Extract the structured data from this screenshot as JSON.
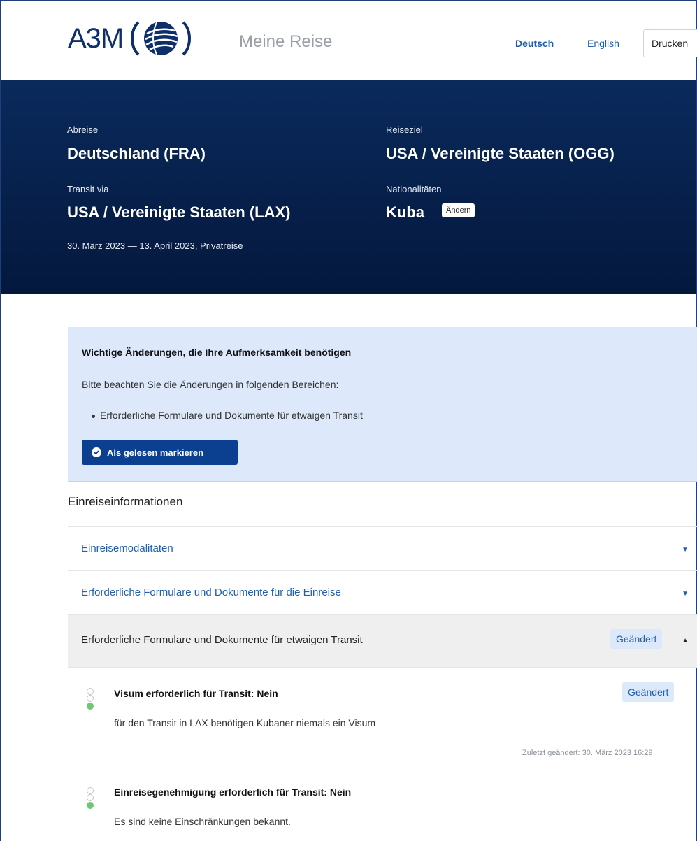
{
  "header": {
    "logo_text": "A3M",
    "tagline": "Meine Reise",
    "lang_de": "Deutsch",
    "lang_en": "English",
    "print_label": "Drucken"
  },
  "trip": {
    "departure_label": "Abreise",
    "departure_value": "Deutschland (FRA)",
    "destination_label": "Reiseziel",
    "destination_value": "USA / Vereinigte Staaten (OGG)",
    "transit_label": "Transit via",
    "transit_value": "USA / Vereinigte Staaten (LAX)",
    "nationality_label": "Nationalitäten",
    "nationality_value": "Kuba",
    "change_label": "Ändern",
    "meta": "30. März 2023 — 13. April 2023, Privatreise"
  },
  "notice": {
    "title": "Wichtige Änderungen, die Ihre Aufmerksamkeit benötigen",
    "text": "Bitte beachten Sie die Änderungen in folgenden Bereichen:",
    "bullet": "Erforderliche Formulare und Dokumente für etwaigen Transit",
    "button_label": "Als gelesen markieren"
  },
  "section_title": "Einreiseinformationen",
  "accordion": {
    "row1": "Einreisemodalitäten",
    "row2": "Erforderliche Formulare und Dokumente für die Einreise",
    "row3": "Erforderliche Formulare und Dokumente für etwaigen Transit",
    "changed_badge": "Geändert",
    "caret_down": "▼",
    "caret_up": "▲"
  },
  "items": [
    {
      "title": "Visum erforderlich für Transit: Nein",
      "text": "für den Transit in LAX benötigen Kubaner niemals ein Visum",
      "badge": "Geändert",
      "stamp": "Zuletzt geändert: 30. März 2023 16:29"
    },
    {
      "title": "Einreisegenehmigung erforderlich für Transit: Nein",
      "text": "Es sind keine Einschränkungen bekannt."
    }
  ]
}
